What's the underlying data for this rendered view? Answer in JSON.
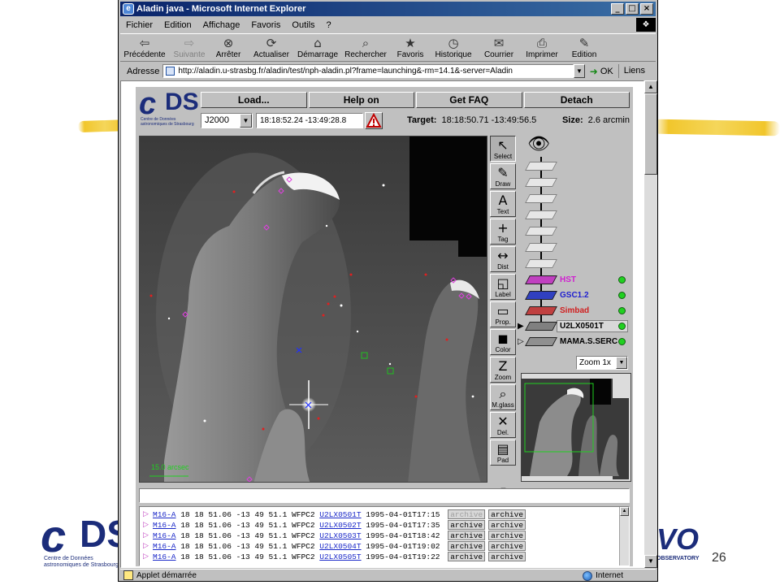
{
  "window": {
    "title": "Aladin java - Microsoft Internet Explorer",
    "controls": [
      "_",
      "□",
      "×"
    ]
  },
  "menu": [
    "Fichier",
    "Edition",
    "Affichage",
    "Favoris",
    "Outils",
    "?"
  ],
  "toolbar": [
    {
      "label": "Précédente",
      "icon": "back-arrow-icon",
      "enabled": true
    },
    {
      "label": "Suivante",
      "icon": "forward-arrow-icon",
      "enabled": false
    },
    {
      "label": "Arrêter",
      "icon": "stop-icon",
      "enabled": true
    },
    {
      "label": "Actualiser",
      "icon": "refresh-icon",
      "enabled": true
    },
    {
      "label": "Démarrage",
      "icon": "home-icon",
      "enabled": true
    },
    {
      "label": "Rechercher",
      "icon": "search-icon",
      "enabled": true
    },
    {
      "label": "Favoris",
      "icon": "favorites-icon",
      "enabled": true
    },
    {
      "label": "Historique",
      "icon": "history-icon",
      "enabled": true
    },
    {
      "label": "Courrier",
      "icon": "mail-icon",
      "enabled": true
    },
    {
      "label": "Imprimer",
      "icon": "print-icon",
      "enabled": true
    },
    {
      "label": "Edition",
      "icon": "edit-icon",
      "enabled": true
    }
  ],
  "address": {
    "label": "Adresse",
    "url": "http://aladin.u-strasbg.fr/aladin/test/nph-aladin.pl?frame=launching&-rm=14.1&-server=Aladin",
    "go_label": "OK",
    "links_label": "Liens"
  },
  "status": {
    "text": "Applet démarrée",
    "zone": "Internet"
  },
  "aladin": {
    "logo_tagline": "Centre de Données astronomiques de Strasbourg",
    "buttons": [
      "Load...",
      "Help on",
      "Get FAQ",
      "Detach"
    ],
    "frame": "J2000",
    "coord_input": "18:18:52.24 -13:49:28.8",
    "target_label": "Target:",
    "target_value": "18:18:50.71 -13:49:56.5",
    "size_label": "Size:",
    "size_value": "2.6 arcmin",
    "scale_label": "15.0 arcsec",
    "tools": [
      {
        "label": "Select",
        "icon": "select-arrow-icon",
        "active": true
      },
      {
        "label": "Draw",
        "icon": "pencil-icon",
        "active": false
      },
      {
        "label": "Text",
        "icon": "text-icon",
        "active": false
      },
      {
        "label": "Tag",
        "icon": "crosshair-icon",
        "active": false
      },
      {
        "label": "Dist",
        "icon": "distance-icon",
        "active": false
      },
      {
        "label": "Label",
        "icon": "label-icon",
        "active": false
      },
      {
        "label": "Prop.",
        "icon": "properties-icon",
        "active": false
      },
      {
        "label": "Color",
        "icon": "color-icon",
        "active": false
      },
      {
        "label": "Zoom",
        "icon": "zoom-icon",
        "active": false
      },
      {
        "label": "M.glass",
        "icon": "magnifier-icon",
        "active": false
      },
      {
        "label": "Del.",
        "icon": "delete-icon",
        "active": false
      },
      {
        "label": "Pad",
        "icon": "pad-icon",
        "active": false
      }
    ],
    "planes": [
      {
        "name": "HST",
        "color": "#d020d0",
        "plane_color": "#c040c0"
      },
      {
        "name": "GSC1.2",
        "color": "#2020d0",
        "plane_color": "#3040c0"
      },
      {
        "name": "Simbad",
        "color": "#d02020",
        "plane_color": "#c04040"
      },
      {
        "name": "U2LX0501T",
        "color": "#000000",
        "plane_color": "#808080"
      },
      {
        "name": "MAMA.S.SERC",
        "color": "#000000",
        "plane_color": "#909090"
      }
    ],
    "zoom": "Zoom 1x",
    "measurements": [
      {
        "obj": "M16-A",
        "coords": "18 18 51.06 -13 49 51.1",
        "inst": "WFPC2",
        "dataset": "U2LX0501T",
        "date": "1995-04-01T17:15",
        "btn1": "archive",
        "btn2": "archive",
        "btn1_dim": true
      },
      {
        "obj": "M16-A",
        "coords": "18 18 51.06 -13 49 51.1",
        "inst": "WFPC2",
        "dataset": "U2LX0502T",
        "date": "1995-04-01T17:35",
        "btn1": "archive",
        "btn2": "archive",
        "btn1_dim": false
      },
      {
        "obj": "M16-A",
        "coords": "18 18 51.06 -13 49 51.1",
        "inst": "WFPC2",
        "dataset": "U2LX0503T",
        "date": "1995-04-01T18:42",
        "btn1": "archive",
        "btn2": "archive",
        "btn1_dim": false
      },
      {
        "obj": "M16-A",
        "coords": "18 18 51.06 -13 49 51.1",
        "inst": "WFPC2",
        "dataset": "U2LX0504T",
        "date": "1995-04-01T19:02",
        "btn1": "archive",
        "btn2": "archive",
        "btn1_dim": false
      },
      {
        "obj": "M16-A",
        "coords": "18 18 51.06 -13 49 51.1",
        "inst": "WFPC2",
        "dataset": "U2LX0505T",
        "date": "1995-04-01T19:22",
        "btn1": "archive",
        "btn2": "archive",
        "btn1_dim": false
      }
    ]
  },
  "slide": {
    "number": "26",
    "footer_logo_tagline": "Centre de Données astronomiques de Strasbourg",
    "avo_logo": "VO",
    "avo_tagline": "OBSERVATORY"
  },
  "colors": {
    "titlebar": "#0a246a",
    "chrome": "#c0c0c0",
    "link": "#1a28c8",
    "logo_blue": "#1b2c7a",
    "brush_yellow": "#f1c62c"
  }
}
